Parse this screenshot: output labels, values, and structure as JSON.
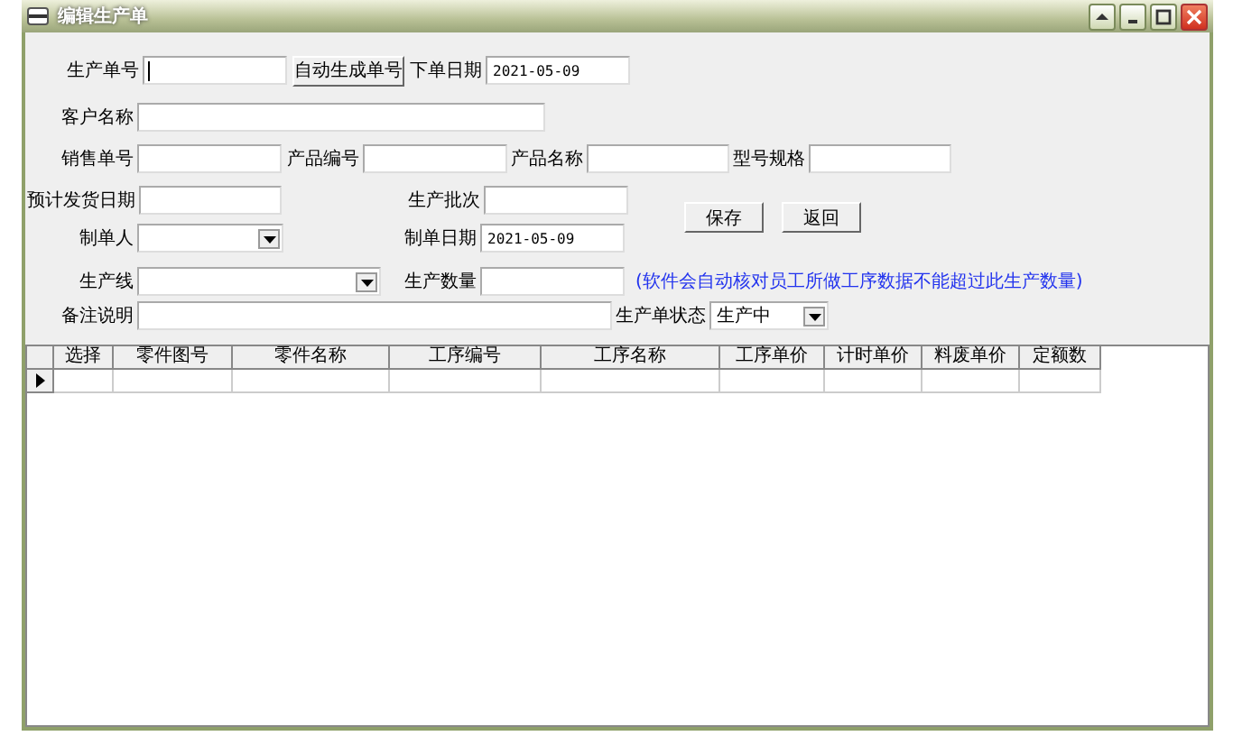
{
  "window": {
    "title": "编辑生产单"
  },
  "rows": [
    [
      {
        "kind": "field",
        "label": "生产单号",
        "focused": true
      },
      {
        "kind": "button",
        "label": "自动生成单号"
      },
      {
        "kind": "field",
        "label": "下单日期",
        "value": "2021-05-09"
      }
    ],
    [
      {
        "kind": "field",
        "label": "客户名称"
      }
    ],
    [
      {
        "kind": "field",
        "label": "销售单号"
      },
      {
        "kind": "field",
        "label": "产品编号"
      },
      {
        "kind": "field",
        "label": "产品名称"
      },
      {
        "kind": "field",
        "label": "型号规格"
      }
    ],
    [
      {
        "kind": "field",
        "label": "预计发货日期"
      },
      {
        "kind": "field",
        "label": "生产批次"
      }
    ],
    [
      {
        "kind": "select",
        "label": "制单人"
      },
      {
        "kind": "field",
        "label": "制单日期",
        "value": "2021-05-09"
      }
    ],
    [
      {
        "kind": "select",
        "label": "生产线"
      },
      {
        "kind": "field",
        "label": "生产数量"
      },
      {
        "kind": "note",
        "label": "(软件会自动核对员工所做工序数据不能超过此生产数量)"
      }
    ],
    [
      {
        "kind": "field",
        "label": "备注说明"
      },
      {
        "kind": "select",
        "label": "生产单状态",
        "value": "生产中"
      }
    ]
  ],
  "actions": [
    "保存",
    "返回"
  ],
  "table": {
    "columns": [
      "选择",
      "零件图号",
      "零件名称",
      "工序编号",
      "工序名称",
      "工序单价",
      "计时单价",
      "料废单价",
      "定额数"
    ],
    "rows": [
      {
        "current": true,
        "cells": [
          "",
          "",
          "",
          "",
          "",
          "",
          "",
          "",
          ""
        ]
      }
    ]
  }
}
